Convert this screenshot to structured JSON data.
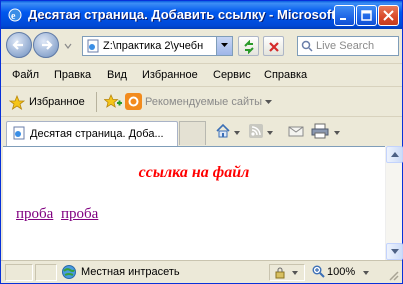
{
  "window": {
    "title": "Десятая страница. Добавить ссылку - Microsoft Internet Explorer"
  },
  "addressbar": {
    "url": "Z:\\практика 2\\учебн",
    "search_placeholder": "Live Search"
  },
  "menu": {
    "items": [
      "Файл",
      "Правка",
      "Вид",
      "Избранное",
      "Сервис",
      "Справка"
    ]
  },
  "favorites": {
    "label": "Избранное",
    "suggested": "Рекомендуемые сайты"
  },
  "tab": {
    "label": "Десятая страница. Доба..."
  },
  "page": {
    "heading": "ссылка на файл",
    "links": [
      "проба",
      "проба"
    ]
  },
  "status": {
    "zone": "Местная интрасеть",
    "zoom": "100%"
  },
  "colors": {
    "heading": "#ff0000",
    "visited_link": "#800080",
    "titlebar": "#0058ee"
  }
}
